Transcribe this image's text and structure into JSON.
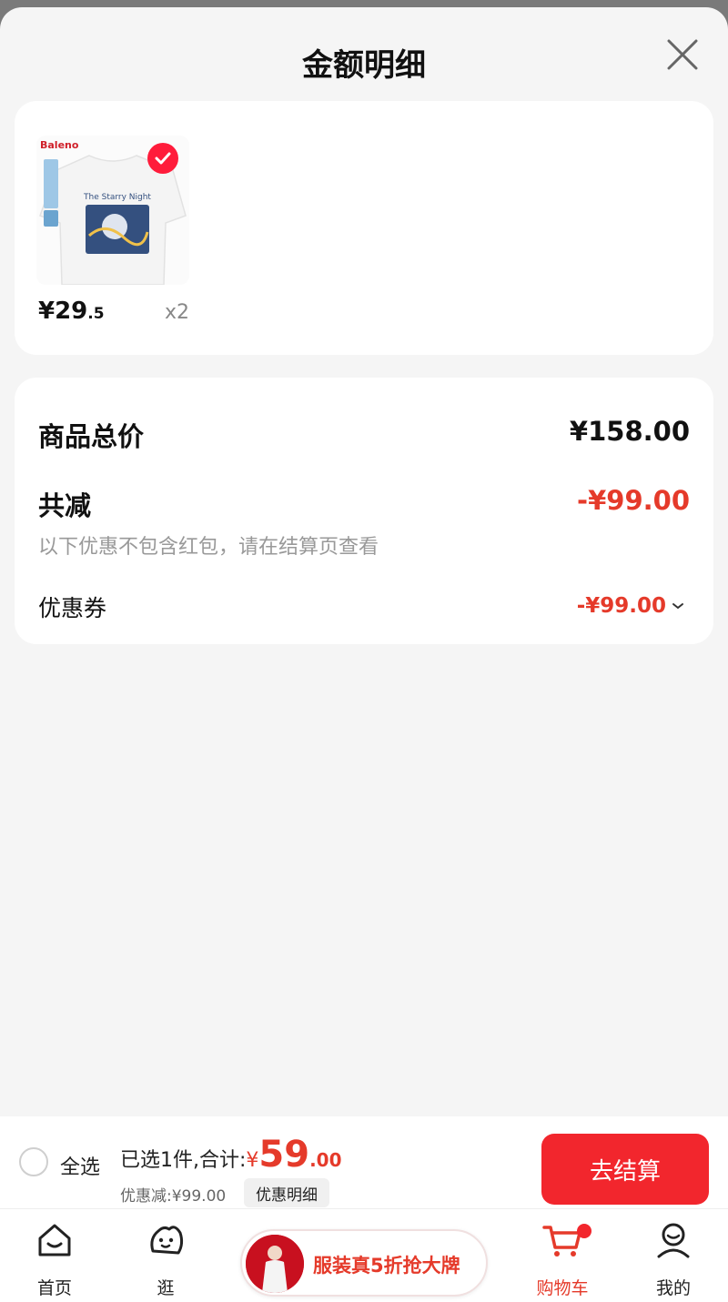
{
  "sheet": {
    "title": "金额明细"
  },
  "product": {
    "brand_logo": "Baleno",
    "price_int": "¥29",
    "price_dec": ".5",
    "quantity": "x2",
    "selected": true
  },
  "summary": {
    "total_label": "商品总价",
    "total_value": "¥158.00",
    "reduce_label": "共减",
    "reduce_value": "-¥99.00",
    "note": "以下优惠不包含红包，请在结算页查看",
    "coupon_label": "优惠券",
    "coupon_value": "-¥99.00"
  },
  "checkout": {
    "select_all": "全选",
    "selected_text": "已选1件,合计:",
    "currency": "¥",
    "total_int": "59",
    "total_dec": ".00",
    "discount_text": "优惠减:¥99.00",
    "detail_button": "优惠明细",
    "checkout_button": "去结算"
  },
  "tabbar": {
    "items": [
      {
        "label": "首页",
        "icon": "home-icon"
      },
      {
        "label": "逛",
        "icon": "browse-icon"
      },
      {
        "label": "购物车",
        "icon": "cart-icon",
        "active": true
      },
      {
        "label": "我的",
        "icon": "profile-icon"
      }
    ],
    "promo": "服装真5折抢大牌"
  },
  "colors": {
    "accent": "#e53a2a",
    "button": "#f2262d",
    "background": "#f5f5f5"
  }
}
